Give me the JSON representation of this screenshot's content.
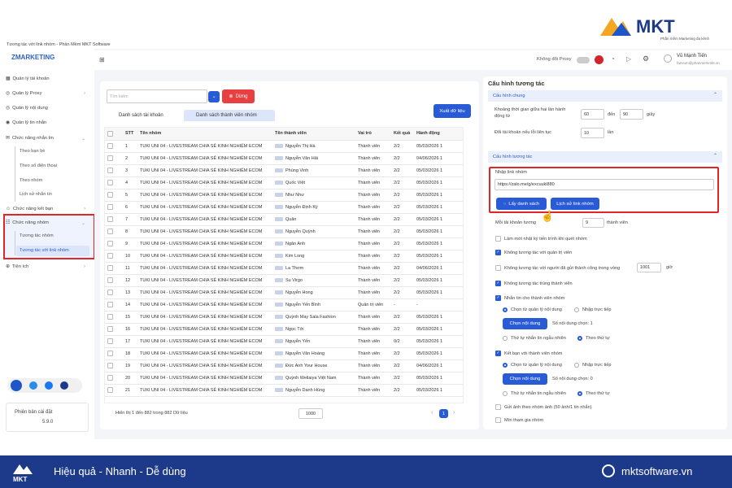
{
  "brand": {
    "name": "MKT",
    "tagline": "Phần mềm Marketing đa kênh",
    "logo_text": "ZMARKETING"
  },
  "window_title": "Tương tác với link nhóm - Phần Mềm MKT Software",
  "sidebar": {
    "items": [
      {
        "label": "Quản lý tài khoản"
      },
      {
        "label": "Quản lý Proxy"
      },
      {
        "label": "Quản lý nội dung"
      },
      {
        "label": "Quản lý tin nhắn"
      },
      {
        "label": "Chức năng nhắn tin"
      },
      {
        "label": "Chức năng kết bạn"
      },
      {
        "label": "Chức năng nhóm"
      },
      {
        "label": "Tiện ích"
      }
    ],
    "msg_subs": [
      "Theo bạn bè",
      "Theo số điện thoại",
      "Theo nhóm",
      "Lịch sử nhắn tin"
    ],
    "group_subs": [
      "Tương tác nhóm",
      "Tương tác với link nhóm"
    ],
    "version_label": "Phiên bản cài đặt",
    "version": "5.9.0"
  },
  "header": {
    "proxy_label": "Không đổi Proxy",
    "user_name": "Vũ Mạnh Tiến",
    "user_email": "fanvum@phanmemmkt.vn"
  },
  "left": {
    "search_placeholder": "Tìm kiếm",
    "stop_label": "Dừng",
    "tabs": [
      "Danh sách tài khoản",
      "Danh sách thành viên nhóm"
    ],
    "export_label": "Xuất dữ liệu",
    "columns": [
      "STT",
      "Tên nhóm",
      "Tên thành viên",
      "Vai trò",
      "Kết quả",
      "Hành động"
    ],
    "rows": [
      [
        "1",
        "TUKI UNI 04 - LIVESTREAM CHIA SẺ KINH NGHIỆM ECOM",
        "Nguyễn Thị Hà",
        "Thành viên",
        "2/2",
        "05/03/2026 1"
      ],
      [
        "2",
        "TUKI UNI 04 - LIVESTREAM CHIA SẺ KINH NGHIỆM ECOM",
        "Nguyễn Văn Hải",
        "Thành viên",
        "2/2",
        "04/06/2026 1"
      ],
      [
        "3",
        "TUKI UNI 04 - LIVESTREAM CHIA SẺ KINH NGHIỆM ECOM",
        "Phùng Vinh",
        "Thành viên",
        "2/2",
        "05/03/2026 1"
      ],
      [
        "4",
        "TUKI UNI 04 - LIVESTREAM CHIA SẺ KINH NGHIỆM ECOM",
        "Quốc Việt",
        "Thành viên",
        "2/2",
        "05/03/2026 1"
      ],
      [
        "5",
        "TUKI UNI 04 - LIVESTREAM CHIA SẺ KINH NGHIỆM ECOM",
        "Như Như",
        "Thành viên",
        "2/2",
        "05/03/2026 1"
      ],
      [
        "6",
        "TUKI UNI 04 - LIVESTREAM CHIA SẺ KINH NGHIỆM ECOM",
        "Nguyễn Định Kỳ",
        "Thành viên",
        "2/2",
        "05/03/2026 1"
      ],
      [
        "7",
        "TUKI UNI 04 - LIVESTREAM CHIA SẺ KINH NGHIỆM ECOM",
        "Quân",
        "Thành viên",
        "2/2",
        "05/03/2026 1"
      ],
      [
        "8",
        "TUKI UNI 04 - LIVESTREAM CHIA SẺ KINH NGHIỆM ECOM",
        "Nguyễn Quỳnh",
        "Thành viên",
        "2/2",
        "05/03/2026 1"
      ],
      [
        "9",
        "TUKI UNI 04 - LIVESTREAM CHIA SẺ KINH NGHIỆM ECOM",
        "Ngân Anh",
        "Thành viên",
        "2/2",
        "05/03/2026 1"
      ],
      [
        "10",
        "TUKI UNI 04 - LIVESTREAM CHIA SẺ KINH NGHIỆM ECOM",
        "Kim Long",
        "Thành viên",
        "2/2",
        "05/03/2026 1"
      ],
      [
        "11",
        "TUKI UNI 04 - LIVESTREAM CHIA SẺ KINH NGHIỆM ECOM",
        "La Thơm",
        "Thành viên",
        "2/2",
        "04/06/2026 1"
      ],
      [
        "12",
        "TUKI UNI 04 - LIVESTREAM CHIA SẺ KINH NGHIỆM ECOM",
        "Su Virgo",
        "Thành viên",
        "2/2",
        "05/03/2026 1"
      ],
      [
        "13",
        "TUKI UNI 04 - LIVESTREAM CHIA SẺ KINH NGHIỆM ECOM",
        "Nguyễn Hong",
        "Thành viên",
        "2/2",
        "05/03/2026 1"
      ],
      [
        "14",
        "TUKI UNI 04 - LIVESTREAM CHIA SẺ KINH NGHIỆM ECOM",
        "Nguyễn Yến Bình",
        "Quản trị viên",
        "-",
        "-"
      ],
      [
        "15",
        "TUKI UNI 04 - LIVESTREAM CHIA SẺ KINH NGHIỆM ECOM",
        "Quỳnh May Sala Fashion",
        "Thành viên",
        "2/2",
        "05/03/2026 1"
      ],
      [
        "16",
        "TUKI UNI 04 - LIVESTREAM CHIA SẺ KINH NGHIỆM ECOM",
        "Ngọc Tới",
        "Thành viên",
        "2/2",
        "05/03/2026 1"
      ],
      [
        "17",
        "TUKI UNI 04 - LIVESTREAM CHIA SẺ KINH NGHIỆM ECOM",
        "Nguyễn Yến",
        "Thành viên",
        "0/2",
        "05/03/2026 1"
      ],
      [
        "18",
        "TUKI UNI 04 - LIVESTREAM CHIA SẺ KINH NGHIỆM ECOM",
        "Nguyễn Văn Hoàng",
        "Thành viên",
        "2/2",
        "05/03/2026 1"
      ],
      [
        "19",
        "TUKI UNI 04 - LIVESTREAM CHIA SẺ KINH NGHIỆM ECOM",
        "Đức Anh Your House",
        "Thành viên",
        "2/2",
        "04/06/2026 1"
      ],
      [
        "20",
        "TUKI UNI 04 - LIVESTREAM CHIA SẺ KINH NGHIỆM ECOM",
        "Quỳnh Weilaiya Việt Nam",
        "Thành viên",
        "2/2",
        "05/03/2026 1"
      ],
      [
        "21",
        "TUKI UNI 04 - LIVESTREAM CHIA SẺ KINH NGHIỆM ECOM",
        "Nguyễn Danh Hùng",
        "Thành viên",
        "2/2",
        "05/03/2026 1"
      ]
    ],
    "footer_text": "Hiển thị 1 đến 882 trong 882 Dữ liệu",
    "page_size": "1000",
    "page": "1"
  },
  "right": {
    "title": "Cấu hình tương tác",
    "general": "Cấu hình chung",
    "delay_label": "Khoảng thời gian giữa hai lần hành động từ",
    "delay_from": "60",
    "to_label": "đến",
    "delay_to": "90",
    "sec": "giây",
    "switch_label": "Đổi tài khoản nếu lỗi liên tục",
    "switch_val": "10",
    "times": "lần",
    "interact": "Cấu hình tương tác",
    "link_label": "Nhập link nhóm",
    "link_val": "https://zalo.me/g/excuuki880",
    "get_btn": "Lấy danh sách",
    "history_btn": "Lịch sử link nhóm",
    "per_acc_label": "Mỗi tài khoản tương",
    "per_acc_val": "9",
    "members": "thành viên",
    "opt1": "Làm mới nhật ký tiến trình khi quét nhóm",
    "opt2": "Không tương tác với quản trị viên",
    "opt3": "Không tương tác với người đã gửi thành công trong vòng",
    "opt3_val": "1001",
    "opt3_unit": "giờ",
    "opt4": "Không tương tác trùng thành viên",
    "opt5": "Nhắn tin cho thành viên nhóm",
    "r_content": "Chọn từ quản lý nội dung",
    "r_direct": "Nhập trực tiếp",
    "pick_btn": "Chọn nội dung",
    "picked1": "Số nội dung chọn: 1",
    "r_random": "Thứ tự nhắn tin ngẫu nhiên",
    "r_order": "Theo thứ tự",
    "opt6": "Kết bạn với thành viên nhóm",
    "picked0": "Số nội dung chọn: 0",
    "opt7": "Gửi ảnh theo nhóm ảnh (50 ảnh/1 tin nhắn)",
    "opt8": "Mời tham gia nhóm"
  },
  "bottom": {
    "slogan": "Hiệu quả - Nhanh - Dễ dùng",
    "site": "mktsoftware.vn"
  },
  "colors": {
    "accent": "#2a5bd7",
    "banner": "#1d3a8a",
    "highlight": "#e0262b",
    "stop": "#e84040"
  }
}
